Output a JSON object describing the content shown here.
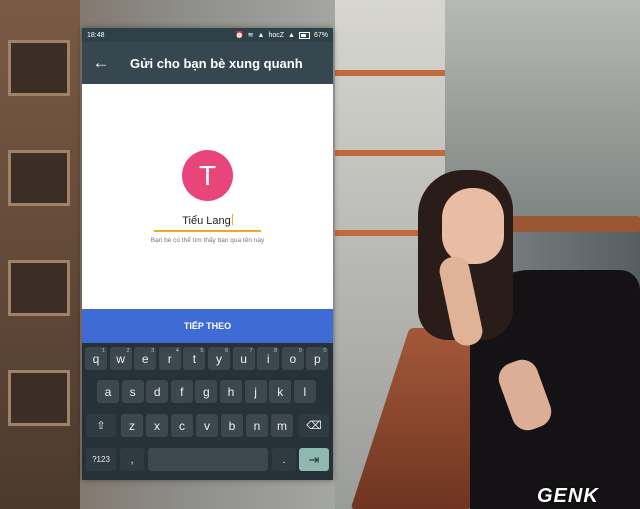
{
  "status_bar": {
    "time": "18:48",
    "carrier": "hocZ",
    "battery": "67%"
  },
  "app_bar": {
    "title": "Gửi cho bạn bè xung quanh"
  },
  "profile": {
    "avatar_letter": "T",
    "avatar_color": "#e8467a",
    "name_value": "Tiểu Lang",
    "hint": "Bạn bè có thể tìm thấy bạn qua tên này"
  },
  "next_button": {
    "label": "TIẾP THEO",
    "color": "#3f6bd4"
  },
  "keyboard": {
    "row1": [
      {
        "k": "q",
        "n": "1"
      },
      {
        "k": "w",
        "n": "2"
      },
      {
        "k": "e",
        "n": "3"
      },
      {
        "k": "r",
        "n": "4"
      },
      {
        "k": "t",
        "n": "5"
      },
      {
        "k": "y",
        "n": "6"
      },
      {
        "k": "u",
        "n": "7"
      },
      {
        "k": "i",
        "n": "8"
      },
      {
        "k": "o",
        "n": "9"
      },
      {
        "k": "p",
        "n": "0"
      }
    ],
    "row2": [
      "a",
      "s",
      "d",
      "f",
      "g",
      "h",
      "j",
      "k",
      "l"
    ],
    "row3": [
      "z",
      "x",
      "c",
      "v",
      "b",
      "n",
      "m"
    ],
    "symbols_label": "?123",
    "period_label": "."
  },
  "watermark": "GENK"
}
